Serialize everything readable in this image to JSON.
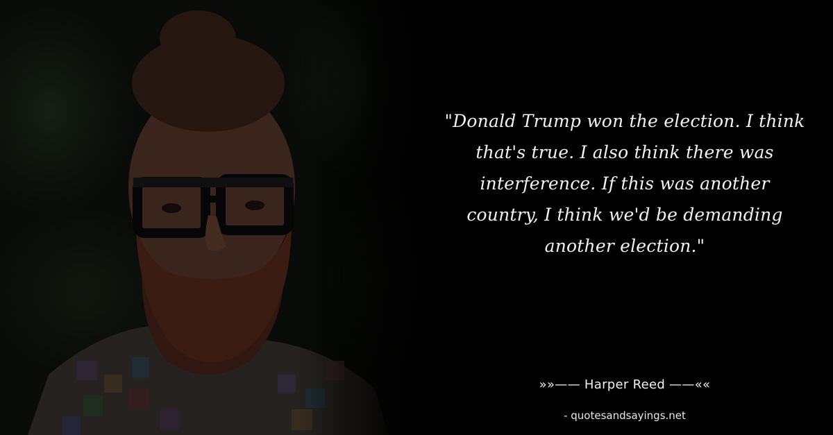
{
  "quote": {
    "lines": [
      "\"Donald Trump won the election. I think",
      "that's true. I also think there was",
      "interference. If this was another",
      "country, I think we'd be demanding",
      "another election.\""
    ]
  },
  "author": "»»—— Harper Reed ——««",
  "website": "- quotesandsayings.net",
  "colors": {
    "background": "#000000",
    "text": "#f2f2f2"
  }
}
